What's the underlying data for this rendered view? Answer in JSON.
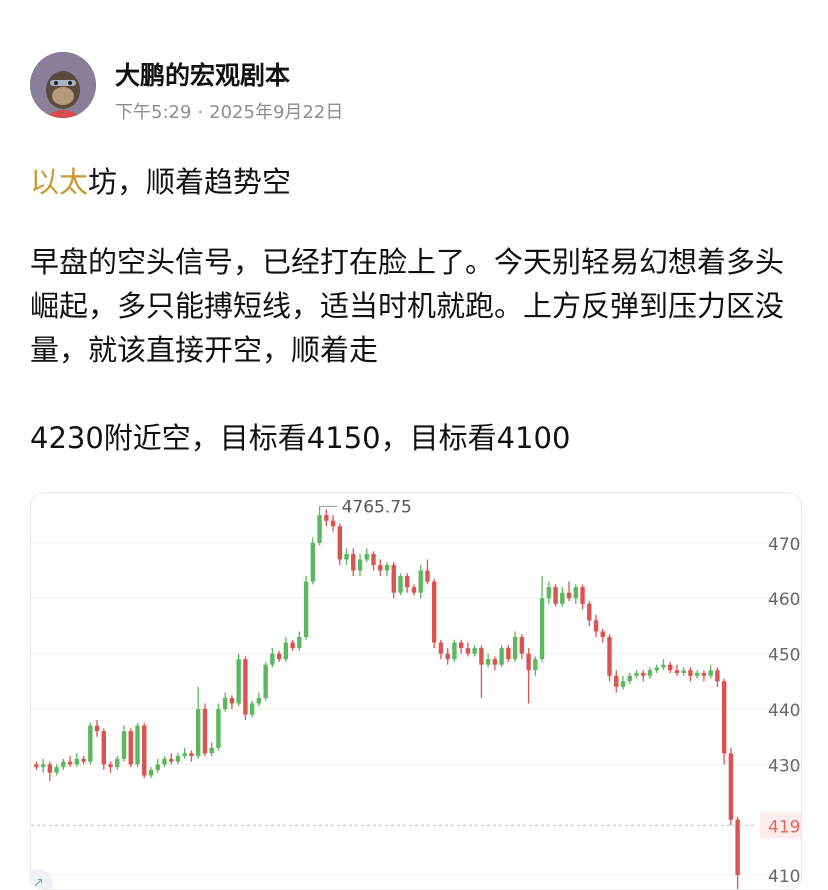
{
  "post": {
    "author": "大鹏的宏观剧本",
    "time": "下午5:29",
    "separator": "·",
    "date": "2025年9月22日",
    "title_highlight": "以太",
    "title_rest": "坊，顺着趋势空",
    "body": "早盘的空头信号，已经打在脸上了。今天别轻易幻想着多头崛起，多只能搏短线，适当时机就跑。上方反弹到压力区没量，就该直接开空，顺着走",
    "targets": "4230附近空，目标看4150，目标看4100"
  },
  "colors": {
    "up": "#5cb85c",
    "down": "#d9534f",
    "highlight": "#c89a33",
    "current": "#e06666"
  },
  "chart_data": {
    "type": "candlestick",
    "y_ticks": [
      "470",
      "460",
      "450",
      "440",
      "430",
      "410"
    ],
    "ylim": [
      4075,
      4790
    ],
    "high_label": "4765.75",
    "high_value": 4765.75,
    "current_price_label": "419",
    "current_price": 4190,
    "candles": [
      [
        4300,
        4295,
        4305,
        4290
      ],
      [
        4295,
        4300,
        4310,
        4285
      ],
      [
        4300,
        4285,
        4305,
        4270
      ],
      [
        4285,
        4295,
        4300,
        4280
      ],
      [
        4295,
        4305,
        4310,
        4290
      ],
      [
        4305,
        4300,
        4315,
        4295
      ],
      [
        4300,
        4310,
        4320,
        4295
      ],
      [
        4310,
        4305,
        4315,
        4300
      ],
      [
        4305,
        4370,
        4375,
        4300
      ],
      [
        4370,
        4360,
        4380,
        4350
      ],
      [
        4360,
        4300,
        4365,
        4290
      ],
      [
        4300,
        4295,
        4305,
        4285
      ],
      [
        4295,
        4310,
        4315,
        4290
      ],
      [
        4310,
        4360,
        4370,
        4305
      ],
      [
        4360,
        4300,
        4365,
        4295
      ],
      [
        4300,
        4370,
        4375,
        4295
      ],
      [
        4370,
        4280,
        4375,
        4275
      ],
      [
        4280,
        4290,
        4295,
        4275
      ],
      [
        4290,
        4300,
        4310,
        4285
      ],
      [
        4300,
        4310,
        4315,
        4295
      ],
      [
        4310,
        4305,
        4320,
        4300
      ],
      [
        4305,
        4315,
        4320,
        4300
      ],
      [
        4315,
        4320,
        4330,
        4310
      ],
      [
        4320,
        4315,
        4325,
        4305
      ],
      [
        4315,
        4400,
        4440,
        4310
      ],
      [
        4400,
        4320,
        4410,
        4315
      ],
      [
        4320,
        4330,
        4340,
        4315
      ],
      [
        4330,
        4400,
        4410,
        4325
      ],
      [
        4400,
        4420,
        4430,
        4395
      ],
      [
        4420,
        4410,
        4425,
        4400
      ],
      [
        4410,
        4490,
        4500,
        4405
      ],
      [
        4490,
        4390,
        4495,
        4380
      ],
      [
        4390,
        4410,
        4415,
        4385
      ],
      [
        4410,
        4420,
        4430,
        4405
      ],
      [
        4420,
        4480,
        4485,
        4415
      ],
      [
        4480,
        4500,
        4510,
        4475
      ],
      [
        4500,
        4490,
        4505,
        4485
      ],
      [
        4490,
        4520,
        4530,
        4485
      ],
      [
        4520,
        4510,
        4525,
        4505
      ],
      [
        4510,
        4530,
        4540,
        4505
      ],
      [
        4530,
        4630,
        4640,
        4525
      ],
      [
        4630,
        4700,
        4710,
        4625
      ],
      [
        4700,
        4750,
        4766,
        4695
      ],
      [
        4750,
        4740,
        4760,
        4730
      ],
      [
        4740,
        4730,
        4750,
        4720
      ],
      [
        4730,
        4670,
        4735,
        4660
      ],
      [
        4670,
        4680,
        4690,
        4660
      ],
      [
        4680,
        4650,
        4690,
        4640
      ],
      [
        4650,
        4670,
        4680,
        4640
      ],
      [
        4670,
        4680,
        4690,
        4665
      ],
      [
        4680,
        4660,
        4685,
        4650
      ],
      [
        4660,
        4650,
        4670,
        4640
      ],
      [
        4650,
        4660,
        4665,
        4640
      ],
      [
        4660,
        4610,
        4665,
        4600
      ],
      [
        4610,
        4640,
        4645,
        4605
      ],
      [
        4640,
        4620,
        4645,
        4610
      ],
      [
        4620,
        4610,
        4625,
        4605
      ],
      [
        4610,
        4650,
        4660,
        4600
      ],
      [
        4650,
        4630,
        4670,
        4625
      ],
      [
        4630,
        4520,
        4635,
        4510
      ],
      [
        4520,
        4500,
        4525,
        4490
      ],
      [
        4500,
        4490,
        4510,
        4480
      ],
      [
        4490,
        4520,
        4525,
        4485
      ],
      [
        4520,
        4510,
        4525,
        4500
      ],
      [
        4510,
        4500,
        4520,
        4495
      ],
      [
        4500,
        4510,
        4515,
        4495
      ],
      [
        4510,
        4480,
        4515,
        4420
      ],
      [
        4480,
        4490,
        4500,
        4475
      ],
      [
        4490,
        4480,
        4495,
        4470
      ],
      [
        4480,
        4510,
        4515,
        4475
      ],
      [
        4510,
        4490,
        4515,
        4485
      ],
      [
        4490,
        4530,
        4540,
        4485
      ],
      [
        4530,
        4500,
        4535,
        4490
      ],
      [
        4500,
        4470,
        4510,
        4410
      ],
      [
        4470,
        4490,
        4495,
        4460
      ],
      [
        4490,
        4600,
        4640,
        4485
      ],
      [
        4600,
        4620,
        4630,
        4590
      ],
      [
        4620,
        4590,
        4625,
        4585
      ],
      [
        4590,
        4610,
        4620,
        4585
      ],
      [
        4610,
        4600,
        4630,
        4595
      ],
      [
        4600,
        4620,
        4625,
        4590
      ],
      [
        4620,
        4590,
        4625,
        4580
      ],
      [
        4590,
        4560,
        4595,
        4550
      ],
      [
        4560,
        4540,
        4570,
        4530
      ],
      [
        4540,
        4530,
        4545,
        4520
      ],
      [
        4530,
        4460,
        4535,
        4450
      ],
      [
        4460,
        4440,
        4470,
        4430
      ],
      [
        4440,
        4450,
        4460,
        4435
      ],
      [
        4450,
        4460,
        4465,
        4445
      ],
      [
        4460,
        4465,
        4470,
        4455
      ],
      [
        4465,
        4460,
        4470,
        4450
      ],
      [
        4460,
        4470,
        4475,
        4455
      ],
      [
        4470,
        4475,
        4480,
        4465
      ],
      [
        4475,
        4480,
        4490,
        4470
      ],
      [
        4480,
        4470,
        4485,
        4465
      ],
      [
        4470,
        4465,
        4480,
        4460
      ],
      [
        4465,
        4470,
        4475,
        4460
      ],
      [
        4470,
        4460,
        4475,
        4450
      ],
      [
        4460,
        4465,
        4470,
        4455
      ],
      [
        4465,
        4460,
        4470,
        4450
      ],
      [
        4460,
        4470,
        4480,
        4455
      ],
      [
        4470,
        4450,
        4475,
        4440
      ],
      [
        4450,
        4320,
        4455,
        4300
      ],
      [
        4320,
        4200,
        4330,
        4190
      ],
      [
        4200,
        4100,
        4205,
        4075
      ]
    ]
  }
}
